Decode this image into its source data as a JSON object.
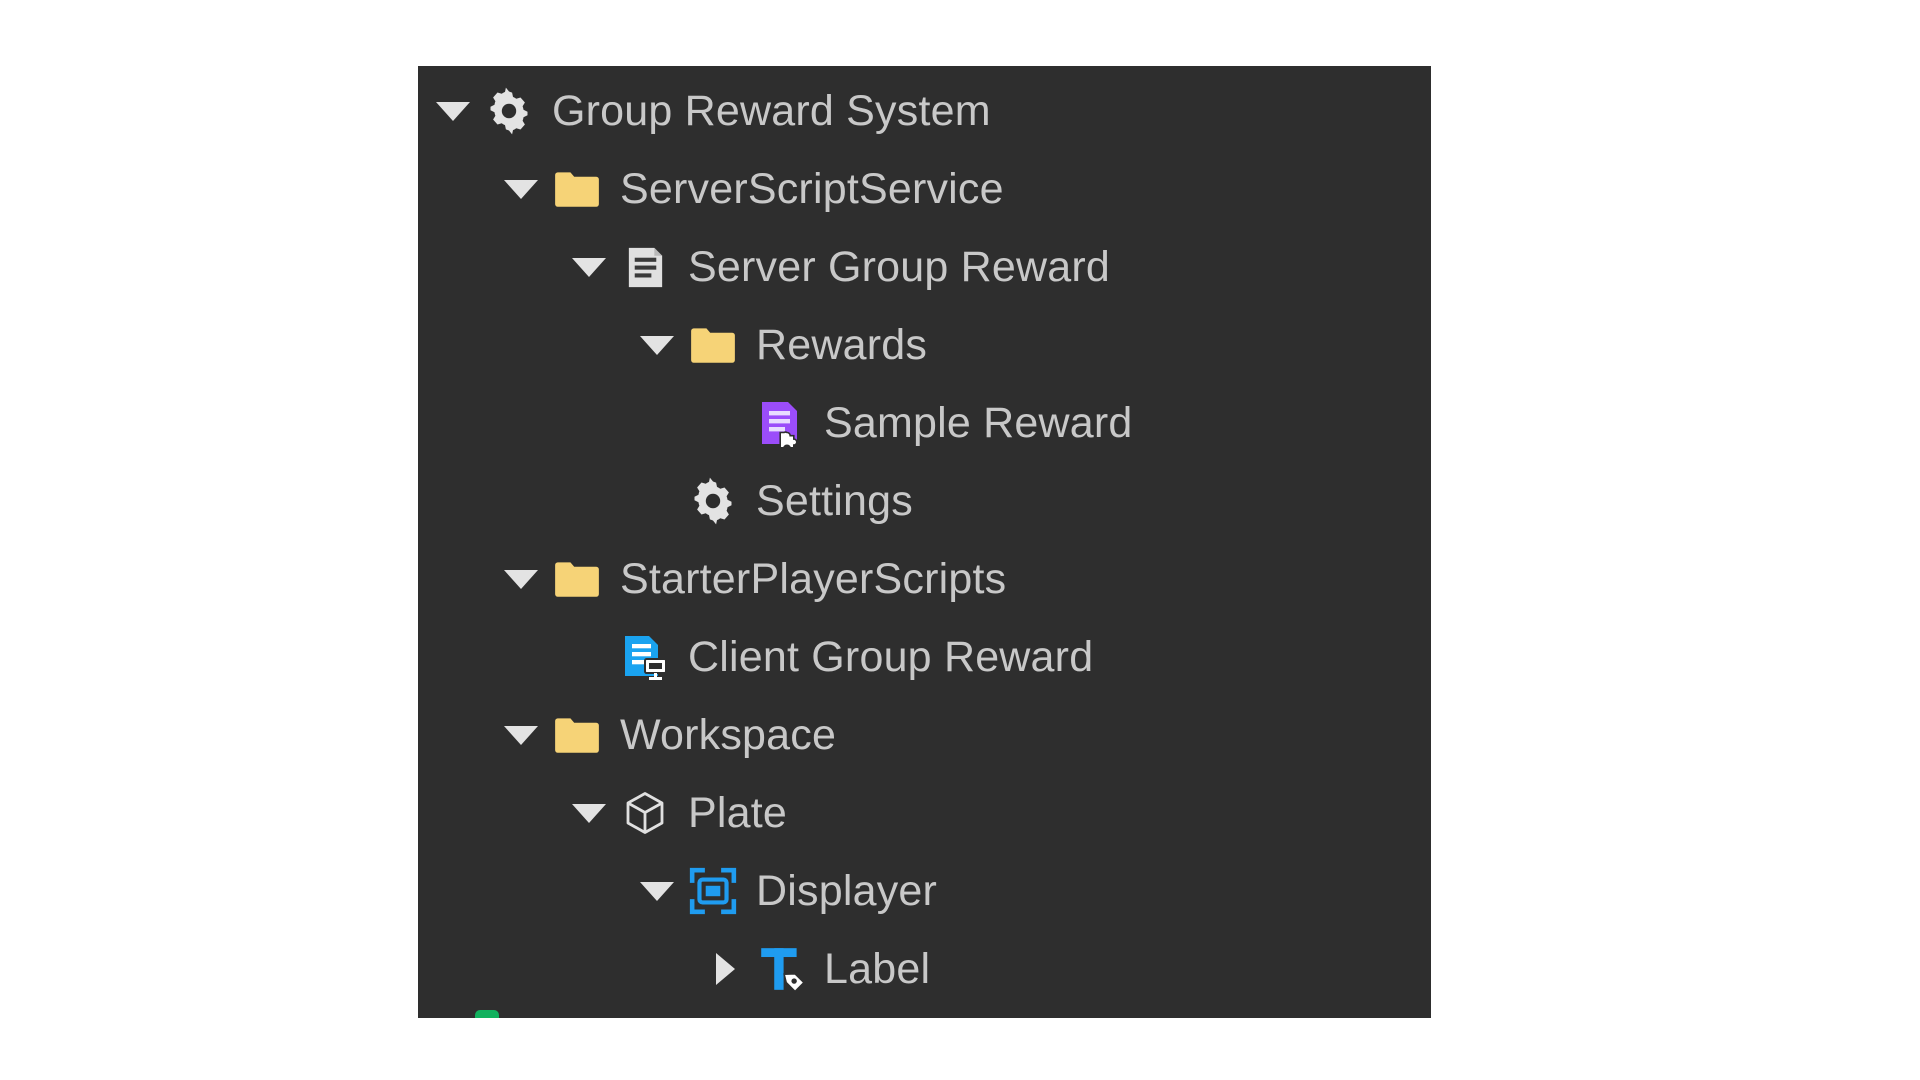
{
  "panel": {
    "name": "Explorer tree panel",
    "background_color": "#2e2e2e",
    "page_background_color": "#ffffff",
    "label_color": "#c8c8c8",
    "twisty_color": "#e3e3e3",
    "accent_colors": {
      "folder_yellow": "#f6d377",
      "module_script_purple": "#9b4dfa",
      "local_script_blue": "#1aa3f0",
      "gui_blue": "#1f9cf0",
      "script_gray": "#e0e0e0",
      "green_sliver": "#12b15e"
    }
  },
  "tree": {
    "rows": [
      {
        "label": "Group Reward System",
        "indent": 0,
        "twisty": "open",
        "icon": "gear-icon"
      },
      {
        "label": "ServerScriptService",
        "indent": 1,
        "twisty": "open",
        "icon": "folder-icon"
      },
      {
        "label": "Server Group Reward",
        "indent": 2,
        "twisty": "open",
        "icon": "script-icon"
      },
      {
        "label": "Rewards",
        "indent": 3,
        "twisty": "open",
        "icon": "folder-icon"
      },
      {
        "label": "Sample Reward",
        "indent": 4,
        "twisty": "none",
        "icon": "module-script-icon"
      },
      {
        "label": "Settings",
        "indent": 3,
        "twisty": "none",
        "icon": "gear-icon"
      },
      {
        "label": "StarterPlayerScripts",
        "indent": 1,
        "twisty": "open",
        "icon": "folder-icon"
      },
      {
        "label": "Client Group Reward",
        "indent": 2,
        "twisty": "none",
        "icon": "local-script-icon"
      },
      {
        "label": "Workspace",
        "indent": 1,
        "twisty": "open",
        "icon": "folder-icon"
      },
      {
        "label": "Plate",
        "indent": 2,
        "twisty": "open",
        "icon": "part-cube-icon"
      },
      {
        "label": "Displayer",
        "indent": 3,
        "twisty": "open",
        "icon": "surface-gui-icon"
      },
      {
        "label": "Label",
        "indent": 4,
        "twisty": "closed",
        "icon": "text-label-icon"
      }
    ]
  }
}
